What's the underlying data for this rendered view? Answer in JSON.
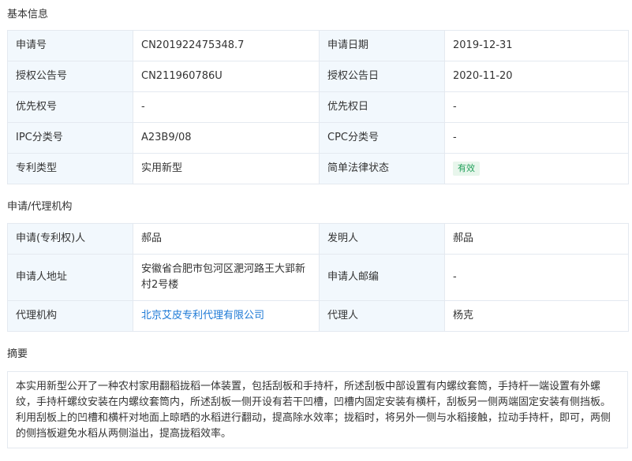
{
  "basic": {
    "title": "基本信息",
    "rows": [
      [
        "申请号",
        "CN201922475348.7",
        "申请日期",
        "2019-12-31"
      ],
      [
        "授权公告号",
        "CN211960786U",
        "授权公告日",
        "2020-11-20"
      ],
      [
        "优先权号",
        "-",
        "优先权日",
        "-"
      ],
      [
        "IPC分类号",
        "A23B9/08",
        "CPC分类号",
        "-"
      ],
      [
        "专利类型",
        "实用新型",
        "简单法律状态",
        "有效"
      ]
    ]
  },
  "agency": {
    "title": "申请/代理机构",
    "rows": [
      [
        "申请(专利权)人",
        "郝品",
        "发明人",
        "郝品"
      ],
      [
        "申请人地址",
        "安徽省合肥市包河区淝河路王大郢新村2号楼",
        "申请人邮编",
        "-"
      ],
      [
        "代理机构",
        "北京艾皮专利代理有限公司",
        "代理人",
        "杨克"
      ]
    ]
  },
  "abstract": {
    "title": "摘要",
    "text": "本实用新型公开了一种农村家用翻稻拢稻一体装置，包括刮板和手持杆，所述刮板中部设置有内螺纹套筒，手持杆一端设置有外螺纹，手持杆螺纹安装在内螺纹套筒内，所述刮板一侧开设有若干凹槽，凹槽内固定安装有横杆，刮板另一侧两端固定安装有侧挡板。利用刮板上的凹槽和横杆对地面上晾晒的水稻进行翻动，提高除水效率；拢稻时，将另外一侧与水稻接触，拉动手持杆，即可，两侧的侧挡板避免水稻从两侧溢出，提高拢稻效率。"
  },
  "colors": {
    "label_bg": "#f2f8fd",
    "border": "#e4e9f0",
    "link": "#1e7ad6",
    "status_badge_bg": "#e8f6ec",
    "status_badge_text": "#22a05a"
  }
}
